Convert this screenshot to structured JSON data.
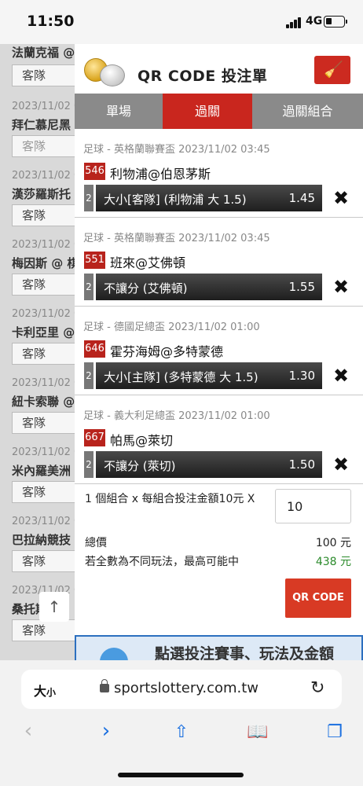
{
  "status_bar": {
    "time": "11:50",
    "network": "4G"
  },
  "background_list": {
    "items": [
      {
        "date": "",
        "team": "法蘭克福 @",
        "button": "客隊",
        "disabled": false
      },
      {
        "date": "2023/11/02 0",
        "team": "拜仁慕尼黑",
        "button": "客隊",
        "disabled": true
      },
      {
        "date": "2023/11/02 0",
        "team": "漢莎羅斯托",
        "button": "客隊",
        "disabled": false
      },
      {
        "date": "2023/11/02 0",
        "team": "梅因斯 @ 棋",
        "button": "客隊",
        "disabled": false
      },
      {
        "date": "2023/11/02 0",
        "team": "卡利亞里 @",
        "button": "客隊",
        "disabled": false
      },
      {
        "date": "2023/11/02 0",
        "team": "紐卡索聯 @",
        "button": "客隊",
        "disabled": false
      },
      {
        "date": "2023/11/02 0",
        "team": "米內羅美洲",
        "button": "客隊",
        "disabled": false
      },
      {
        "date": "2023/11/02 0",
        "team": "巴拉納競技",
        "button": "客隊",
        "disabled": false
      },
      {
        "date": "2023/11/02 0",
        "team": "桑托斯",
        "button": "客隊",
        "disabled": false
      }
    ],
    "up_arrow": "↑"
  },
  "panel": {
    "title": "QR CODE 投注單",
    "tabs": [
      "單場",
      "過關",
      "過關組合"
    ],
    "active_tab": "過關",
    "bets": [
      {
        "league": "足球 - 英格蘭聯賽盃 2023/11/02 03:45",
        "code": "546",
        "match": "利物浦@伯恩茅斯",
        "num": "2",
        "selection": "大小[客隊] (利物浦 大 1.5)",
        "odds": "1.45"
      },
      {
        "league": "足球 - 英格蘭聯賽盃 2023/11/02 03:45",
        "code": "551",
        "match": "班來@艾佛頓",
        "num": "2",
        "selection": "不讓分 (艾佛頓)",
        "odds": "1.55"
      },
      {
        "league": "足球 - 德國足總盃 2023/11/02 01:00",
        "code": "646",
        "match": "霍芬海姆@多特蒙德",
        "num": "2",
        "selection": "大小[主隊] (多特蒙德 大 1.5)",
        "odds": "1.30"
      },
      {
        "league": "足球 - 義大利足總盃 2023/11/02 01:00",
        "code": "667",
        "match": "帕馬@萊切",
        "num": "2",
        "selection": "不讓分 (萊切)",
        "odds": "1.50"
      }
    ],
    "remove_icon": "✖",
    "summary": {
      "combo_text": "1 個組合 x 每組合投注金額10元 X",
      "amount_value": "10",
      "total_label": "總價",
      "total_value": "100 元",
      "max_label": "若全數為不同玩法，最高可能中",
      "max_value": "438 元"
    },
    "qr_button": "QR CODE",
    "promo_text": "點選投注賽事、玩法及金額"
  },
  "browser": {
    "text_size": "大",
    "text_size_small": "小",
    "url": "sportslottery.com.tw"
  },
  "colors": {
    "accent_red": "#c9261e",
    "tab_gray": "#8a8a8a",
    "win_green": "#2a8a2a",
    "link_blue": "#1a6fe0"
  }
}
